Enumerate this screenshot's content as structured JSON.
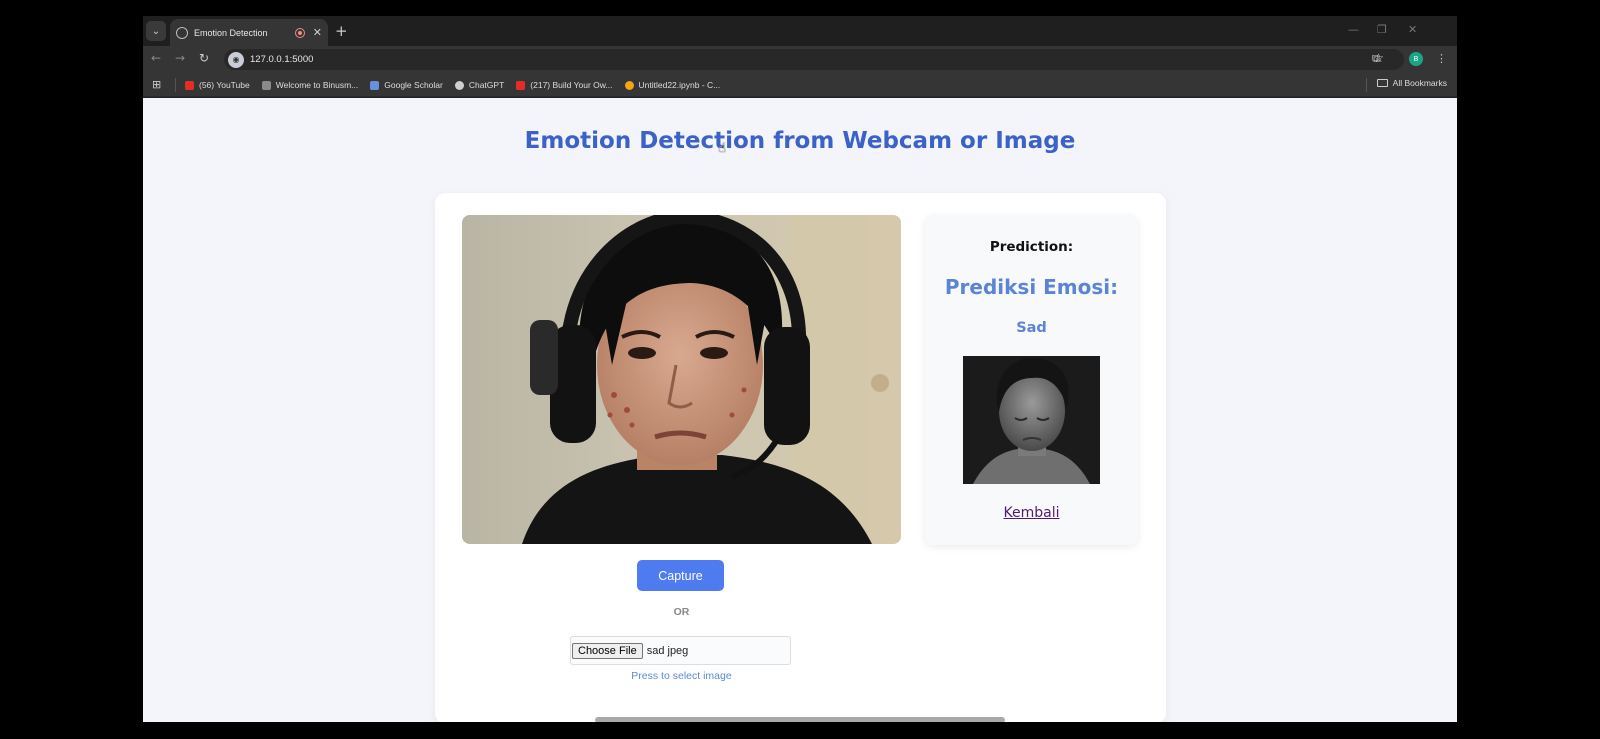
{
  "browser": {
    "tab_title": "Emotion Detection",
    "url": "127.0.0.1:5000",
    "profile_initial": "B",
    "bookmarks": [
      {
        "label": "(56) YouTube",
        "color": "#e52d27"
      },
      {
        "label": "Welcome to Binusm...",
        "color": "#8a8a8a"
      },
      {
        "label": "Google Scholar",
        "color": "#6b8fe0"
      },
      {
        "label": "ChatGPT",
        "color": "#cfcfcf"
      },
      {
        "label": "(217) Build Your Ow...",
        "color": "#e52d27"
      },
      {
        "label": "Untitled22.ipynb - C...",
        "color": "#f2a516"
      }
    ],
    "all_bookmarks": "All Bookmarks"
  },
  "page": {
    "title": "Emotion Detection from Webcam or Image",
    "capture_label": "Capture",
    "or_label": "OR",
    "choose_file_label": "Choose File",
    "file_name": "sad jpeg",
    "hint": "Press to select image",
    "prediction_label": "Prediction:",
    "prediction_heading": "Prediksi Emosi:",
    "prediction_value": "Sad",
    "back_link": "Kembali"
  },
  "colors": {
    "title": "#3b62c9",
    "accent": "#4f7bf0",
    "prediction": "#5b84d6"
  }
}
